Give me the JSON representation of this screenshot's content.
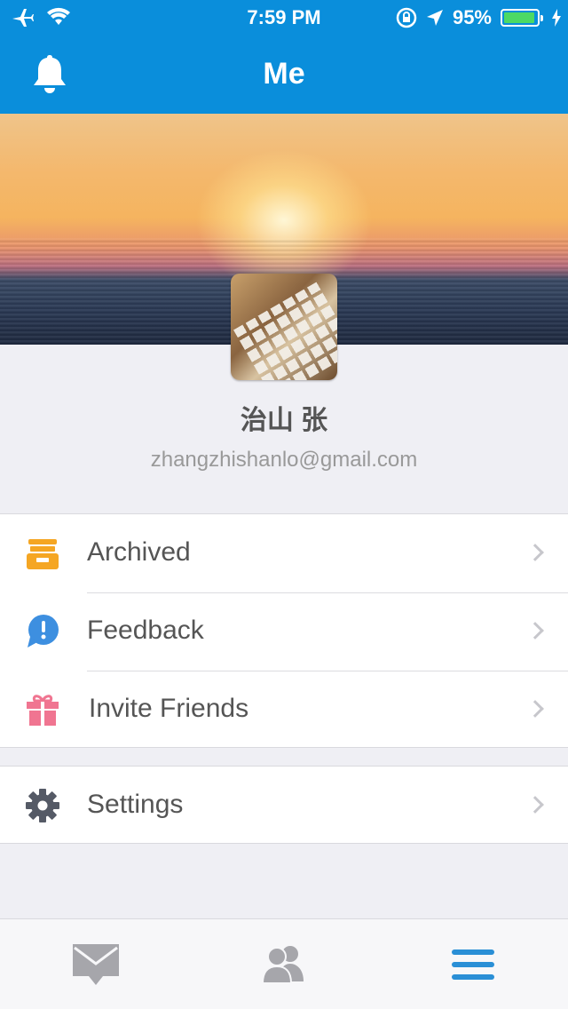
{
  "status_bar": {
    "time": "7:59 PM",
    "battery_percent": "95%",
    "battery_level": 0.95,
    "icons": [
      "airplane-icon",
      "wifi-icon",
      "rotation-lock-icon",
      "location-arrow-icon",
      "battery-icon",
      "charging-icon"
    ]
  },
  "nav": {
    "title": "Me",
    "left_icon": "bell-icon"
  },
  "profile": {
    "name": "治山 张",
    "email": "zhangzhishanlo@gmail.com"
  },
  "menu": {
    "group1": [
      {
        "label": "Archived",
        "icon": "archive-box-icon",
        "color": "#f5a623"
      },
      {
        "label": "Feedback",
        "icon": "feedback-bubble-icon",
        "color": "#3d8fe0"
      },
      {
        "label": "Invite Friends",
        "icon": "gift-icon",
        "color": "#f07591"
      }
    ],
    "group2": [
      {
        "label": "Settings",
        "icon": "gear-icon",
        "color": "#555a66"
      }
    ]
  },
  "tabbar": {
    "tabs": [
      {
        "icon": "mail-icon",
        "active": false
      },
      {
        "icon": "contacts-icon",
        "active": false
      },
      {
        "icon": "menu-icon",
        "active": true
      }
    ],
    "active_color": "#2a8fd6",
    "inactive_color": "#a6a6ab"
  },
  "colors": {
    "header": "#0a8edb",
    "background": "#efeff4"
  }
}
